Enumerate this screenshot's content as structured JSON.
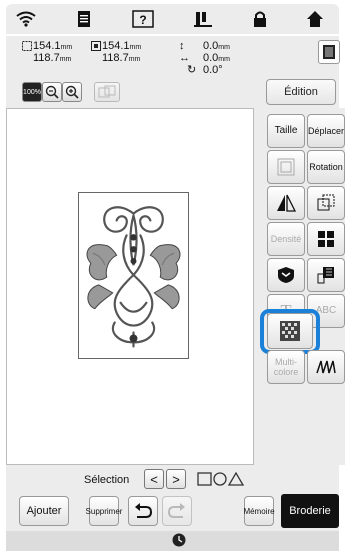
{
  "status": {
    "icons": [
      "wifi-icon",
      "document-icon",
      "help-icon",
      "bobbin-icon",
      "lock-icon",
      "home-icon"
    ]
  },
  "measurements": {
    "width_total": "154.1",
    "height_total": "118.7",
    "width_pattern": "154.1",
    "height_pattern": "118.7",
    "unit": "mm",
    "offset_v": "0.0",
    "offset_h": "0.0",
    "angle": "0.0°"
  },
  "toolbar": {
    "zoom_label": "100%"
  },
  "tabs": {
    "edition": "Édition"
  },
  "panel": {
    "taille": "Taille",
    "deplacer": "Déplacer",
    "rotation": "Rotation",
    "densite": "Densité",
    "abc": "ABC",
    "multicolore": "Multi-colore"
  },
  "selection": {
    "label": "Sélection",
    "prev": "<",
    "next": ">"
  },
  "bottom": {
    "ajouter": "Ajouter",
    "supprimer": "Supprimer",
    "memoire": "Mémoire",
    "broderie": "Broderie"
  },
  "colors": {
    "highlight": "#1a80d8",
    "panel_bg": "#ececec"
  }
}
